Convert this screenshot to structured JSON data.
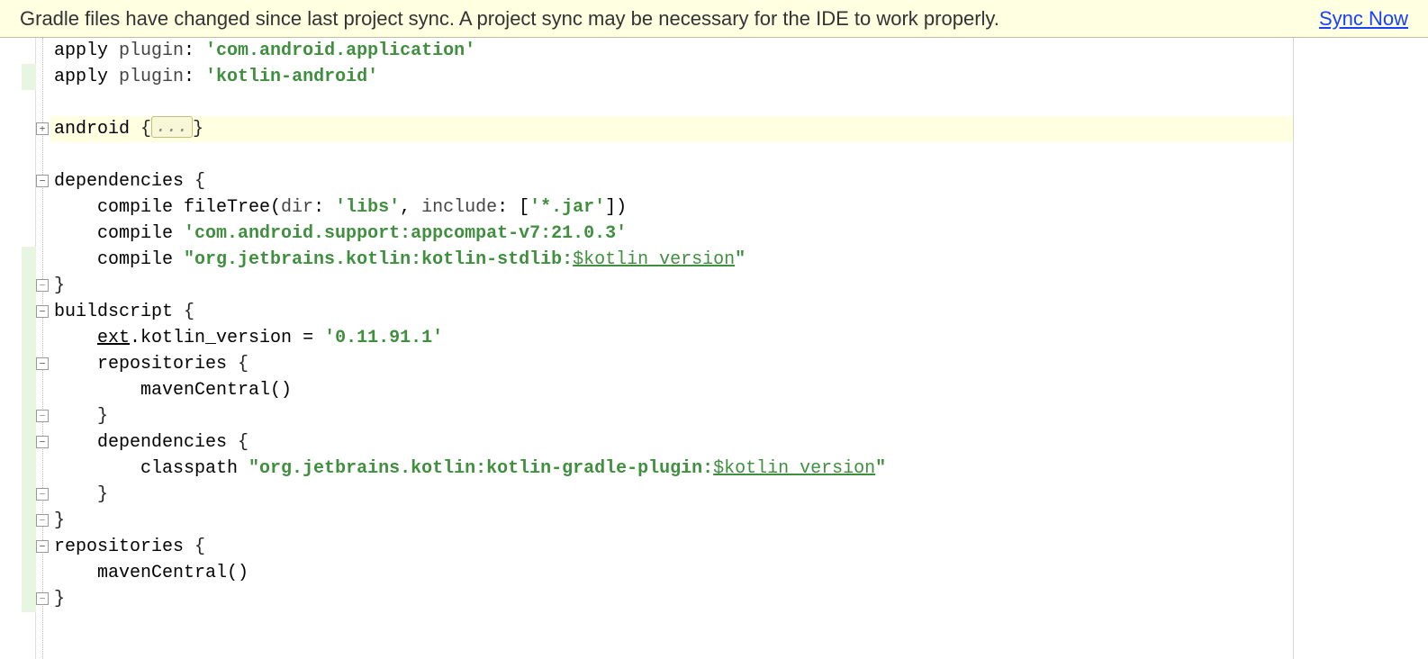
{
  "notification": {
    "message": "Gradle files have changed since last project sync. A project sync may be necessary for the IDE to work properly.",
    "action_label": "Sync Now"
  },
  "editor": {
    "folded_placeholder": "...",
    "lines": [
      {
        "i": 0,
        "fold": "",
        "hl": false,
        "segs": [
          {
            "t": "apply ",
            "c": ""
          },
          {
            "t": "plugin",
            "c": "param"
          },
          {
            "t": ": ",
            "c": ""
          },
          {
            "t": "'com.android.application'",
            "c": "kw"
          }
        ]
      },
      {
        "i": 1,
        "fold": "",
        "hl": false,
        "segs": [
          {
            "t": "apply ",
            "c": ""
          },
          {
            "t": "plugin",
            "c": "param"
          },
          {
            "t": ": ",
            "c": ""
          },
          {
            "t": "'kotlin-android'",
            "c": "kw"
          }
        ]
      },
      {
        "i": 2,
        "fold": "",
        "hl": false,
        "segs": []
      },
      {
        "i": 3,
        "fold": "open",
        "hl": true,
        "segs": [
          {
            "t": "android ",
            "c": ""
          },
          {
            "t": "{",
            "c": "punc folded"
          }
        ]
      },
      {
        "i": 4,
        "fold": "",
        "hl": false,
        "segs": []
      },
      {
        "i": 5,
        "fold": "close",
        "hl": false,
        "segs": [
          {
            "t": "dependencies ",
            "c": ""
          },
          {
            "t": "{",
            "c": "punc"
          }
        ]
      },
      {
        "i": 6,
        "fold": "",
        "hl": false,
        "segs": [
          {
            "t": "    compile fileTree(",
            "c": ""
          },
          {
            "t": "dir",
            "c": "param"
          },
          {
            "t": ": ",
            "c": ""
          },
          {
            "t": "'libs'",
            "c": "kw"
          },
          {
            "t": ", ",
            "c": ""
          },
          {
            "t": "include",
            "c": "param"
          },
          {
            "t": ": [",
            "c": ""
          },
          {
            "t": "'*.jar'",
            "c": "kw"
          },
          {
            "t": "])",
            "c": ""
          }
        ]
      },
      {
        "i": 7,
        "fold": "",
        "hl": false,
        "segs": [
          {
            "t": "    compile ",
            "c": ""
          },
          {
            "t": "'com.android.support:appcompat-v7:21.0.3'",
            "c": "kw"
          }
        ]
      },
      {
        "i": 8,
        "fold": "",
        "hl": false,
        "segs": [
          {
            "t": "    compile ",
            "c": ""
          },
          {
            "t": "\"org.jetbrains.kotlin:kotlin-stdlib:",
            "c": "kw"
          },
          {
            "t": "$kotlin_version",
            "c": "kw2 under"
          },
          {
            "t": "\"",
            "c": "kw"
          }
        ]
      },
      {
        "i": 9,
        "fold": "end",
        "hl": false,
        "segs": [
          {
            "t": "}",
            "c": "punc"
          }
        ]
      },
      {
        "i": 10,
        "fold": "close",
        "hl": false,
        "segs": [
          {
            "t": "buildscript ",
            "c": ""
          },
          {
            "t": "{",
            "c": "punc"
          }
        ]
      },
      {
        "i": 11,
        "fold": "",
        "hl": false,
        "segs": [
          {
            "t": "    ",
            "c": ""
          },
          {
            "t": "ext",
            "c": "under"
          },
          {
            "t": ".kotlin_version = ",
            "c": ""
          },
          {
            "t": "'0.11.91.1'",
            "c": "kw"
          }
        ]
      },
      {
        "i": 12,
        "fold": "close",
        "hl": false,
        "segs": [
          {
            "t": "    repositories ",
            "c": ""
          },
          {
            "t": "{",
            "c": "punc"
          }
        ]
      },
      {
        "i": 13,
        "fold": "",
        "hl": false,
        "segs": [
          {
            "t": "        mavenCentral()",
            "c": ""
          }
        ]
      },
      {
        "i": 14,
        "fold": "end",
        "hl": false,
        "segs": [
          {
            "t": "    }",
            "c": "punc"
          }
        ]
      },
      {
        "i": 15,
        "fold": "close",
        "hl": false,
        "segs": [
          {
            "t": "    dependencies ",
            "c": ""
          },
          {
            "t": "{",
            "c": "punc"
          }
        ]
      },
      {
        "i": 16,
        "fold": "",
        "hl": false,
        "segs": [
          {
            "t": "        classpath ",
            "c": ""
          },
          {
            "t": "\"org.jetbrains.kotlin:kotlin-gradle-plugin:",
            "c": "kw"
          },
          {
            "t": "$kotlin_version",
            "c": "kw2 under"
          },
          {
            "t": "\"",
            "c": "kw"
          }
        ]
      },
      {
        "i": 17,
        "fold": "end",
        "hl": false,
        "segs": [
          {
            "t": "    }",
            "c": "punc"
          }
        ]
      },
      {
        "i": 18,
        "fold": "end",
        "hl": false,
        "segs": [
          {
            "t": "}",
            "c": "punc"
          }
        ]
      },
      {
        "i": 19,
        "fold": "close",
        "hl": false,
        "segs": [
          {
            "t": "repositories ",
            "c": ""
          },
          {
            "t": "{",
            "c": "punc"
          }
        ]
      },
      {
        "i": 20,
        "fold": "",
        "hl": false,
        "segs": [
          {
            "t": "    mavenCentral()",
            "c": ""
          }
        ]
      },
      {
        "i": 21,
        "fold": "end",
        "hl": false,
        "segs": [
          {
            "t": "}",
            "c": "punc"
          }
        ]
      }
    ],
    "change_bars": [
      {
        "from": 1,
        "to": 1
      },
      {
        "from": 8,
        "to": 21
      }
    ]
  }
}
